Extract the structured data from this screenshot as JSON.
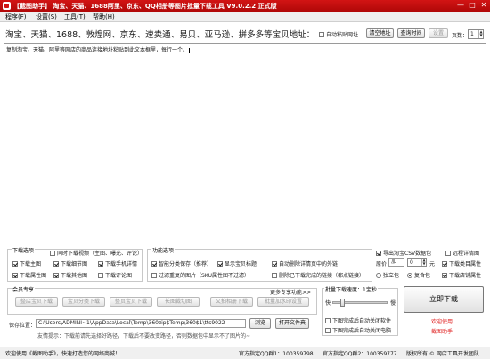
{
  "window": {
    "title": "【截图助手】 淘宝、天猫、1688阿里、京东、QQ相册等图片批量下载工具 V9.0.2.2 正式版",
    "minimize_glyph": "—",
    "maximize_glyph": "□",
    "close_glyph": "✕"
  },
  "menu": [
    "程序(F)",
    "设置(S)",
    "工具(T)",
    "帮助(H)"
  ],
  "headline": "淘宝、天猫、1688、敦煌网、京东、速卖通、易贝、亚马逊、拼多多等宝贝地址：",
  "auto_paste_label": "自动粘贴网址",
  "clear_button": "清空地址",
  "query_button": "查询时间",
  "settings_button": "设置",
  "pages_label": "页数：",
  "pages_value": "1",
  "textarea_text": "复制淘宝、天猫、阿里等网店的商品连接地址粘贴到此文本框里，每行一个。",
  "download_options": {
    "title": "下载选项",
    "items": [
      {
        "label": "同时下载视频（主图、曝光、评论）",
        "checked": false
      },
      {
        "label": "下载主图",
        "checked": true
      },
      {
        "label": "下载细节图",
        "checked": true
      },
      {
        "label": "下载手机详情",
        "checked": true
      },
      {
        "label": "下载属性图",
        "checked": true
      },
      {
        "label": "下载其他图",
        "checked": true
      },
      {
        "label": "下载评论图",
        "checked": false
      }
    ]
  },
  "func_options": {
    "title": "功能选项",
    "items": [
      {
        "label": "智能分类保存（推荐）",
        "checked": true
      },
      {
        "label": "显示宝贝标题",
        "checked": true
      },
      {
        "label": "自动删除详情页中的外链",
        "checked": true
      },
      {
        "label": "过滤重复的图片（SKU属性图不过滤）",
        "checked": false
      },
      {
        "label": "删除已下载完成的链接（都点链接）",
        "checked": false
      }
    ]
  },
  "right_options": {
    "export_csv": {
      "label": "导出淘宝CSV数据包",
      "checked": true
    },
    "wide_detail": {
      "label": "远程详情图",
      "checked": false
    },
    "original_label": "原价",
    "original_value": "加",
    "price_value": "0",
    "price_unit": "元",
    "download_cat": {
      "label": "下载类目属性",
      "checked": true
    },
    "radio_single": {
      "label": "独立包",
      "checked": false
    },
    "radio_shared": {
      "label": "复合包",
      "checked": true
    },
    "download_shop": {
      "label": "下载店铺属性",
      "checked": true
    }
  },
  "member": {
    "title": "会员专享",
    "more": "更多专享功能>>",
    "row1": [
      "整店宝贝下载",
      "宝贝分类下载",
      "整页宝贝下载",
      "长图裁切图"
    ],
    "row2": [
      "又拍相册下载",
      "批量加水印设置"
    ]
  },
  "speed": {
    "title": "批量下载速度：1宝秒",
    "fast": "快",
    "slow": "慢",
    "shutdown_after": "下图完成后自动关闭软件",
    "poweroff_after": "下图完成后自动关闭电脑"
  },
  "save": {
    "label": "保存位置：",
    "path": "C:\\Users\\ADMINI~1\\AppData\\Local\\Temp\\360zip$Temp\\360$1\\tts9022",
    "browse": "浏览",
    "open_folder": "打开文件夹",
    "tip": "友情提示：下载前请先选择好路径，下载后不要改变路径，否则数据包中显示不了图片的~"
  },
  "start_button": "立即下载",
  "welcome_link": "欢迎使用",
  "help_link": "截图助手",
  "status": {
    "left": "欢迎使用《截图助手》，快速打造您的网络商城！",
    "qq1": "官方指定QQ群1：100359798",
    "qq2": "官方指定QQ群2：100359777",
    "copyright": "版权所有 © 网店工具开发团队"
  },
  "colors": {
    "title_bar": "#d21414",
    "accent_red": "#e02020"
  }
}
